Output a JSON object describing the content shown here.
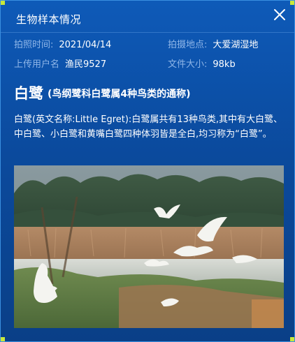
{
  "panel": {
    "title": "生物样本情况",
    "close_icon": "close-icon"
  },
  "meta": {
    "shot_time": {
      "label": "拍照时间:",
      "value": "2021/04/14"
    },
    "location": {
      "label": "拍摄地点:",
      "value": "大爱湖湿地"
    },
    "uploader": {
      "label": "上传用户名",
      "value": "渔民9527"
    },
    "file_size": {
      "label": "文件大小:",
      "value": "98kb"
    }
  },
  "species": {
    "name": "白鹭",
    "subtitle": "(鸟纲鹭科白鹭属4种鸟类的通称)",
    "description": "白鹭(英文名称:Little Egret):白鹭属共有13种鸟类,其中有大白鹭、中白鹭、小白鹭和黄嘴白鹭四种体羽皆是全白,均习称为“白鹭”。"
  },
  "colors": {
    "accent_corner": "#c8e83a",
    "label": "#8fb6e8",
    "panel_bg": "#0e5ab8"
  }
}
